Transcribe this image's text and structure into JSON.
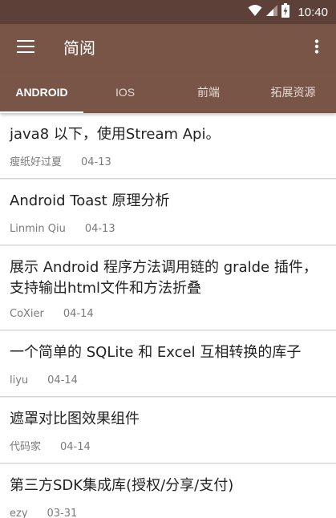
{
  "status_bar": {
    "time": "10:40",
    "icons": [
      "wifi-icon",
      "signal-icon",
      "battery-icon"
    ]
  },
  "app_bar": {
    "title": "简阅",
    "menu_icon": "hamburger-menu-icon",
    "overflow_icon": "more-vert-icon"
  },
  "tabs": [
    {
      "label": "ANDROID",
      "active": true
    },
    {
      "label": "IOS",
      "active": false
    },
    {
      "label": "前端",
      "active": false
    },
    {
      "label": "拓展资源",
      "active": false
    }
  ],
  "articles": [
    {
      "title": "java8 以下，使用Stream Api。",
      "author": "瘦纸好过夏",
      "date": "04-13"
    },
    {
      "title": "Android Toast 原理分析",
      "author": "Linmin Qiu",
      "date": "04-13"
    },
    {
      "title": "展示 Android 程序方法调用链的 gralde 插件，支持输出html文件和方法折叠",
      "author": "CoXier",
      "date": "04-14"
    },
    {
      "title": "一个简单的 SQLite 和 Excel 互相转换的库子",
      "author": "liyu",
      "date": "04-14"
    },
    {
      "title": "遮罩对比图效果组件",
      "author": "代码家",
      "date": "04-14"
    },
    {
      "title": "第三方SDK集成库(授权/分享/支付)",
      "author": "ezy",
      "date": "03-31"
    }
  ],
  "colors": {
    "status_bar": "#5d4037",
    "app_bar": "#795548",
    "tab_indicator": "#ffffff"
  }
}
